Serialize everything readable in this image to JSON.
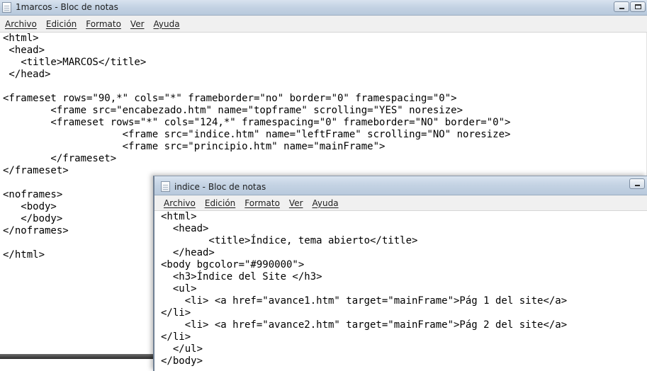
{
  "windows": {
    "back": {
      "title": "1marcos - Bloc de notas",
      "menu": [
        "Archivo",
        "Edición",
        "Formato",
        "Ver",
        "Ayuda"
      ],
      "content": "<html>\n <head>\n   <title>MARCOS</title>\n </head>\n\n<frameset rows=\"90,*\" cols=\"*\" frameborder=\"no\" border=\"0\" framespacing=\"0\">\n        <frame src=\"encabezado.htm\" name=\"topframe\" scrolling=\"YES\" noresize>\n        <frameset rows=\"*\" cols=\"124,*\" framespacing=\"0\" frameborder=\"NO\" border=\"0\">\n                    <frame src=\"indice.htm\" name=\"leftFrame\" scrolling=\"NO\" noresize>\n                    <frame src=\"principio.htm\" name=\"mainFrame\">\n        </frameset>\n</frameset>\n\n<noframes>\n   <body>\n   </body>\n</noframes>\n\n</html>"
    },
    "front": {
      "title": "indice - Bloc de notas",
      "menu": [
        "Archivo",
        "Edición",
        "Formato",
        "Ver",
        "Ayuda"
      ],
      "content": "<html>\n  <head>\n        <title>Índice, tema abierto</title>\n  </head>\n<body bgcolor=\"#990000\">\n  <h3>Índice del Site </h3>\n  <ul>\n    <li> <a href=\"avance1.htm\" target=\"mainFrame\">Pág 1 del site</a>\n</li>\n    <li> <a href=\"avance2.htm\" target=\"mainFrame\">Pág 2 del site</a>\n</li>\n  </ul>\n</body>"
    }
  },
  "icons": {
    "app": "notepad-icon",
    "minimize": "minimize-icon",
    "maximize": "maximize-icon"
  },
  "colors": {
    "titlebar": "#c3d2e3",
    "menubar": "#f0f0f0",
    "editor_bg": "#ffffff",
    "text": "#000000"
  }
}
